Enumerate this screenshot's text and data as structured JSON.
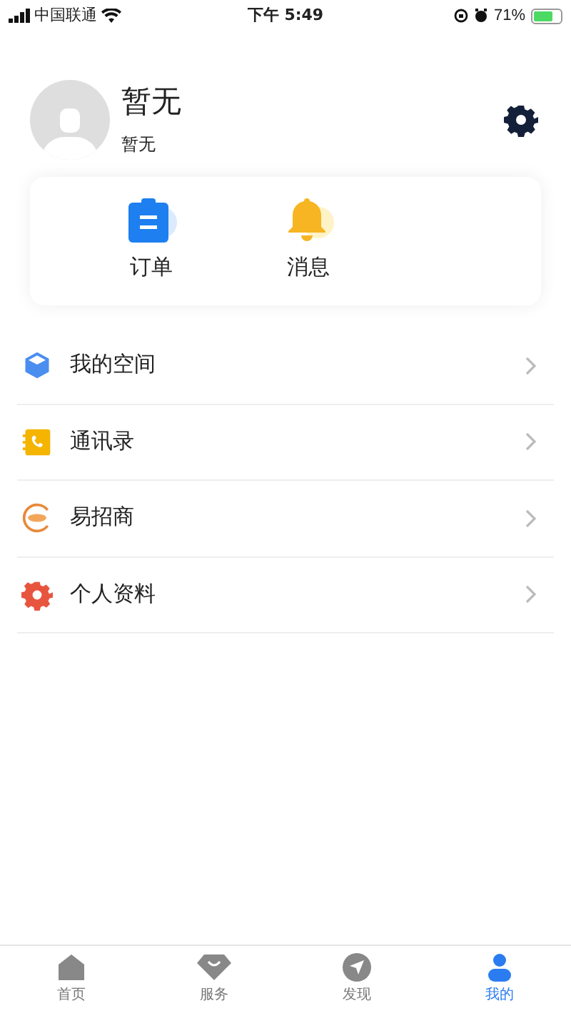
{
  "status_bar": {
    "carrier": "中国联通",
    "time": "下午 5:49",
    "battery": "71%"
  },
  "profile": {
    "name": "暂无",
    "subtitle": "暂无"
  },
  "shortcuts": [
    {
      "kind": "order",
      "label": "订单"
    },
    {
      "kind": "bell",
      "label": "消息"
    }
  ],
  "menu": [
    {
      "kind": "cube",
      "label": "我的空间"
    },
    {
      "kind": "contacts",
      "label": "通讯录"
    },
    {
      "kind": "crm",
      "label": "易招商"
    },
    {
      "kind": "gear",
      "label": "个人资料"
    }
  ],
  "tab_bar": [
    {
      "kind": "home",
      "label": "首页",
      "selected": false
    },
    {
      "kind": "service",
      "label": "服务",
      "selected": false
    },
    {
      "kind": "discover",
      "label": "发现",
      "selected": false
    },
    {
      "kind": "me",
      "label": "我的",
      "selected": true
    }
  ]
}
